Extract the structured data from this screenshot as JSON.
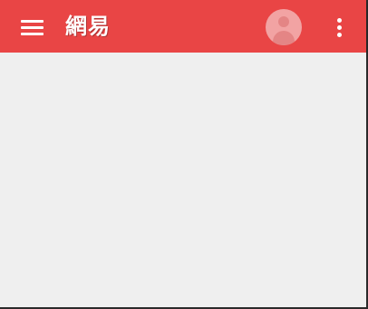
{
  "app_bar": {
    "title": "網易",
    "background_color": "#e94545",
    "menu_icon": "hamburger-menu-icon",
    "avatar_icon": "user-avatar-icon",
    "overflow_icon": "more-vert-icon"
  },
  "content": {
    "background_color": "#efefef"
  }
}
